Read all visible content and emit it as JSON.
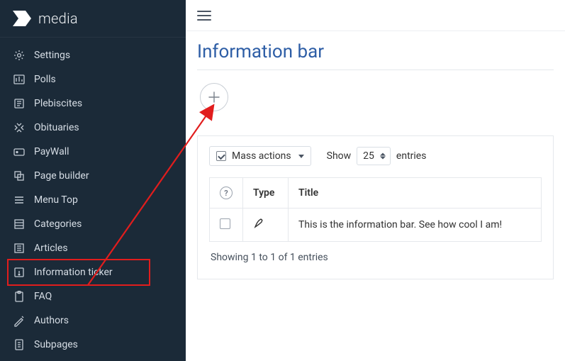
{
  "brand": {
    "name": "media"
  },
  "sidebar": {
    "items": [
      {
        "label": "Settings"
      },
      {
        "label": "Polls"
      },
      {
        "label": "Plebiscites"
      },
      {
        "label": "Obituaries"
      },
      {
        "label": "PayWall"
      },
      {
        "label": "Page builder"
      },
      {
        "label": "Menu Top"
      },
      {
        "label": "Categories"
      },
      {
        "label": "Articles"
      },
      {
        "label": "Information ticker"
      },
      {
        "label": "FAQ"
      },
      {
        "label": "Authors"
      },
      {
        "label": "Subpages"
      }
    ],
    "highlight_index": 9
  },
  "page": {
    "title": "Information bar"
  },
  "toolbar": {
    "mass_actions_label": "Mass actions",
    "show_label": "Show",
    "entries_label": "entries",
    "page_size": "25"
  },
  "table": {
    "columns": {
      "type": "Type",
      "title": "Title"
    },
    "rows": [
      {
        "title": "This is the information bar. See how cool I am!"
      }
    ],
    "info": "Showing 1 to 1 of 1 entries"
  }
}
